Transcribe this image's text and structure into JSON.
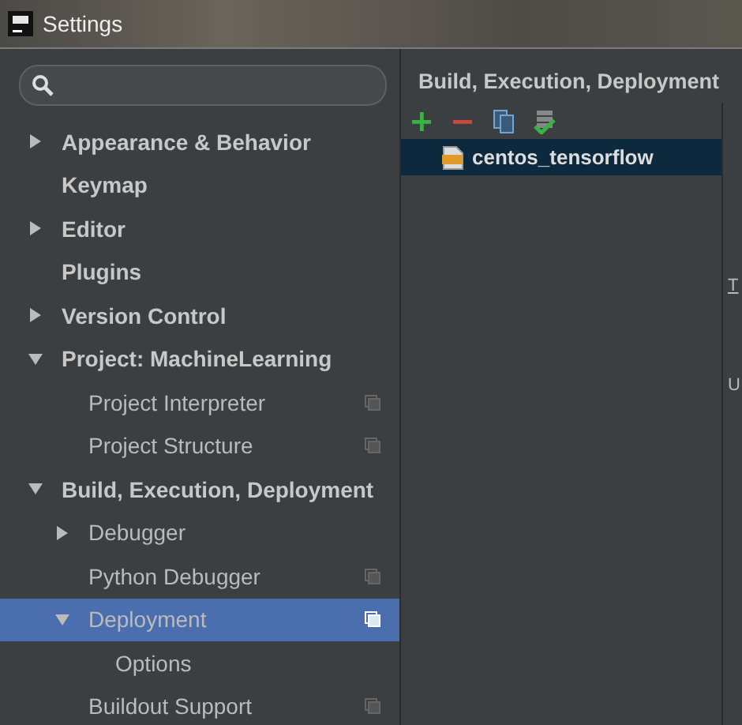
{
  "window": {
    "title": "Settings"
  },
  "tree": [
    {
      "label": "Appearance & Behavior",
      "expandable": true,
      "expanded": false,
      "selected": false,
      "project_icon": false
    },
    {
      "label": "Keymap",
      "expandable": false,
      "selected": false,
      "project_icon": false
    },
    {
      "label": "Editor",
      "expandable": true,
      "expanded": false,
      "selected": false,
      "project_icon": false
    },
    {
      "label": "Plugins",
      "expandable": false,
      "selected": false,
      "project_icon": false
    },
    {
      "label": "Version Control",
      "expandable": true,
      "expanded": false,
      "selected": false,
      "project_icon": false
    },
    {
      "label": "Project: MachineLearning",
      "expandable": true,
      "expanded": true,
      "selected": false,
      "project_icon": false,
      "children": [
        {
          "label": "Project Interpreter",
          "expandable": false,
          "selected": false,
          "project_icon": true
        },
        {
          "label": "Project Structure",
          "expandable": false,
          "selected": false,
          "project_icon": true
        }
      ]
    },
    {
      "label": "Build, Execution, Deployment",
      "expandable": true,
      "expanded": true,
      "selected": false,
      "project_icon": false,
      "children": [
        {
          "label": "Debugger",
          "expandable": true,
          "expanded": false,
          "selected": false,
          "project_icon": false
        },
        {
          "label": "Python Debugger",
          "expandable": false,
          "selected": false,
          "project_icon": true
        },
        {
          "label": "Deployment",
          "expandable": true,
          "expanded": true,
          "selected": true,
          "project_icon": true,
          "children": [
            {
              "label": "Options",
              "expandable": false,
              "selected": false,
              "project_icon": false
            }
          ]
        },
        {
          "label": "Buildout Support",
          "expandable": false,
          "selected": false,
          "project_icon": true
        }
      ]
    }
  ],
  "panel": {
    "breadcrumb": "Build, Execution, Deployment",
    "servers": [
      {
        "name": "centos_tensorflow",
        "selected": true
      }
    ],
    "edge_labels": [
      "T",
      "U"
    ]
  }
}
